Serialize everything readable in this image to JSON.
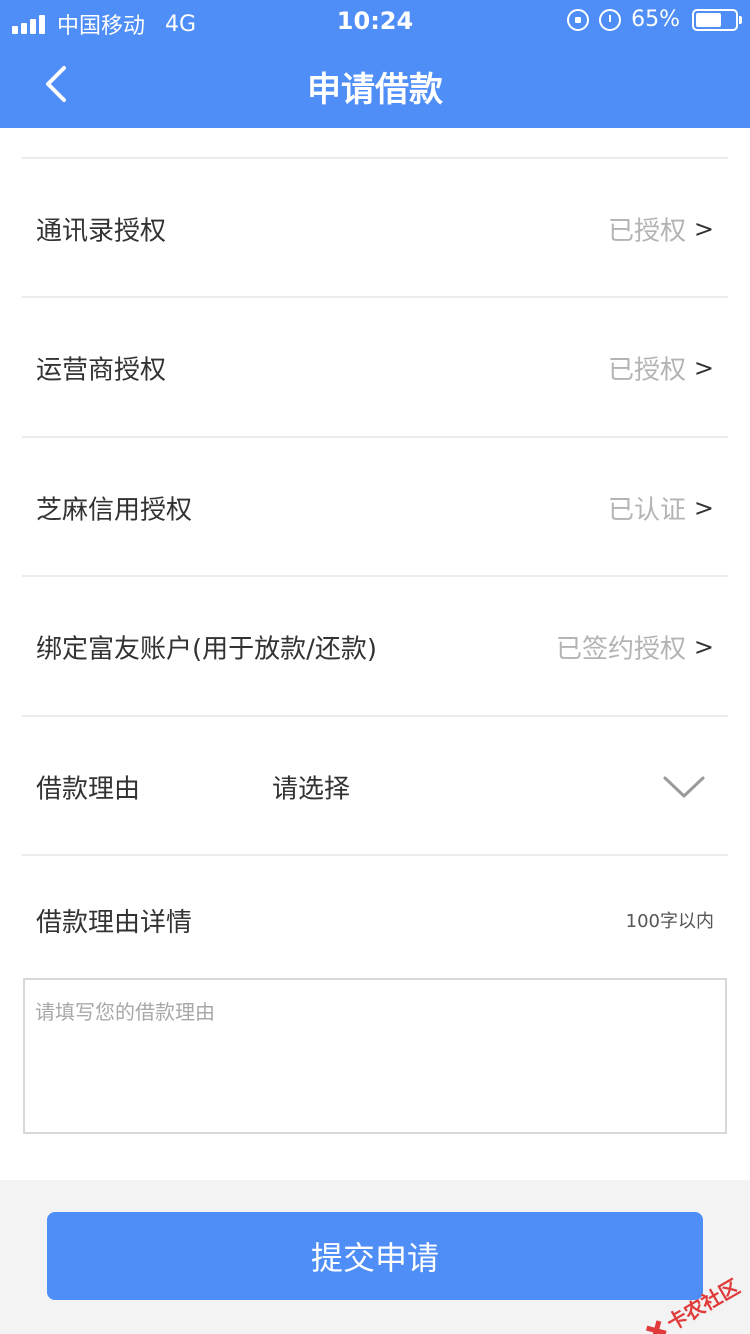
{
  "status_bar": {
    "carrier": "中国移动",
    "network": "4G",
    "time": "10:24",
    "battery": "65%",
    "battery_level": 0.65
  },
  "nav": {
    "title": "申请借款",
    "back_icon": "chevron-left-icon"
  },
  "auth_items": [
    {
      "label": "通讯录授权",
      "status": "已授权",
      "chevron": ">"
    },
    {
      "label": "运营商授权",
      "status": "已授权",
      "chevron": ">"
    },
    {
      "label": "芝麻信用授权",
      "status": "已认证",
      "chevron": ">"
    },
    {
      "label": "绑定富友账户(用于放款/还款)",
      "status": "已签约授权",
      "chevron": ">"
    }
  ],
  "reason": {
    "label": "借款理由",
    "value": "请选择",
    "icon": "chevron-down-icon"
  },
  "detail": {
    "label": "借款理由详情",
    "limit": "100字以内",
    "placeholder": "请填写您的借款理由"
  },
  "submit": {
    "label": "提交申请"
  },
  "watermark": {
    "text": "卡农社区"
  },
  "colors": {
    "primary": "#4f8ef7",
    "muted_text": "#b4b4b4",
    "footer_bg": "#f3f3f3",
    "watermark": "#e03a3a"
  }
}
